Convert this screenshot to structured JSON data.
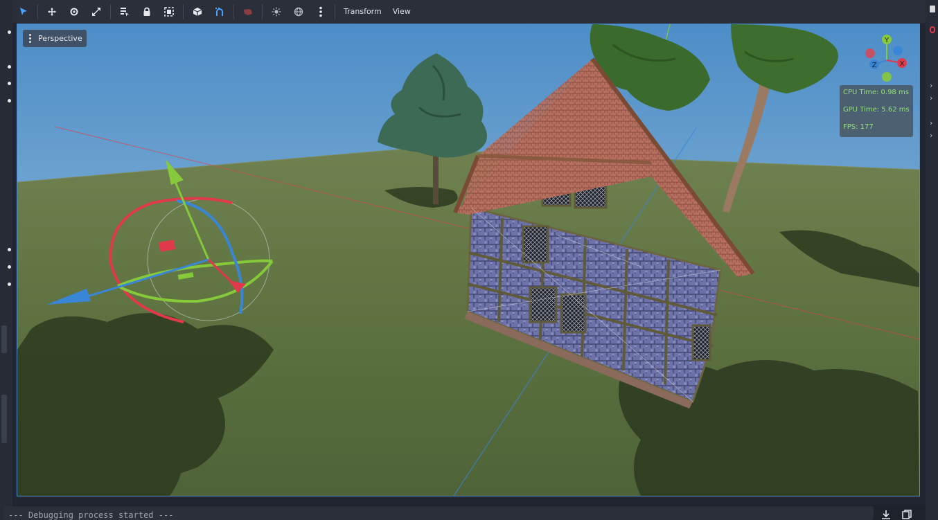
{
  "toolbar": {
    "tools": [
      {
        "name": "select-tool-icon",
        "active": true
      },
      {
        "name": "move-tool-icon"
      },
      {
        "name": "rotate-tool-icon"
      },
      {
        "name": "scale-tool-icon"
      },
      {
        "name": "list-select-icon"
      },
      {
        "name": "lock-icon"
      },
      {
        "name": "group-icon"
      },
      {
        "name": "local-space-icon"
      },
      {
        "name": "snap-icon"
      },
      {
        "name": "camera-preview-icon"
      },
      {
        "name": "sun-icon"
      },
      {
        "name": "environment-icon"
      },
      {
        "name": "more-options-icon"
      }
    ],
    "transform_label": "Transform",
    "view_label": "View"
  },
  "viewport": {
    "perspective_label": "Perspective",
    "stats": {
      "cpu": "CPU Time: 0.98 ms",
      "gpu": "GPU Time: 5.62 ms",
      "fps": "FPS: 177"
    },
    "axis_gizmo": {
      "y": "Y",
      "x": "X",
      "z": "Z"
    }
  },
  "colors": {
    "accent": "#4f8fcf",
    "x_axis": "#e0394b",
    "y_axis": "#86c93a",
    "z_axis": "#3a86d6",
    "stats_text": "#93e07a"
  },
  "console": {
    "line": "--- Debugging process started ---"
  }
}
